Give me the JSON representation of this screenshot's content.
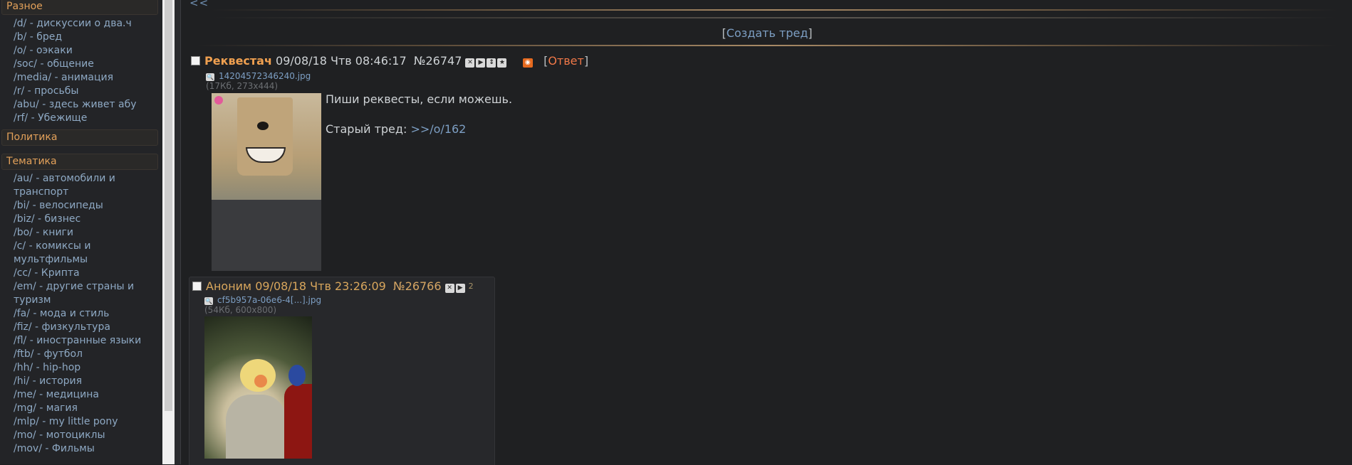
{
  "sidebar": {
    "categories": [
      {
        "title": "Разное",
        "boards": [
          "/d/ - дискуссии о два.ч",
          "/b/ - бред",
          "/o/ - оэкаки",
          "/soc/ - общение",
          "/media/ - анимация",
          "/r/ - просьбы",
          "/abu/ - здесь живет абу",
          "/rf/ - Убежище"
        ]
      },
      {
        "title": "Политика",
        "boards": []
      },
      {
        "title": "Тематика",
        "boards": [
          "/au/ - автомобили и транспорт",
          "/bi/ - велосипеды",
          "/biz/ - бизнес",
          "/bo/ - книги",
          "/c/ - комиксы и мультфильмы",
          "/cc/ - Крипта",
          "/em/ - другие страны и туризм",
          "/fa/ - мода и стиль",
          "/fiz/ - физкультура",
          "/fl/ - иностранные языки",
          "/ftb/ - футбол",
          "/hh/ - hip-hop",
          "/hi/ - история",
          "/me/ - медицина",
          "/mg/ - магия",
          "/mlp/ - my little pony",
          "/mo/ - мотоциклы",
          "/mov/ - Фильмы"
        ]
      }
    ]
  },
  "nav": {
    "back": "<<"
  },
  "create_thread": {
    "open": "[",
    "label": "Создать тред",
    "close": "]"
  },
  "colors": {
    "background": "#1f2022",
    "accent": "#f0a050",
    "link": "#7d9fc4",
    "reply": "#f07848"
  },
  "op": {
    "subject": "Реквестач",
    "date": "09/08/18 Чтв 08:46:17",
    "number": "№26747",
    "icons": [
      "hide-icon",
      "play-icon",
      "expand-icon",
      "star-icon"
    ],
    "rss_icon": "rss-icon",
    "reply_open": "[",
    "reply_label": "Ответ",
    "reply_close": "]",
    "file_name": "14204572346240.jpg",
    "file_meta": "(17Кб, 273x444)",
    "text_line1": "Пиши реквесты, если можешь.",
    "text_line2_prefix": "Старый тред: ",
    "text_line2_link": ">>/o/162"
  },
  "reply": {
    "author": "Аноним",
    "date": "09/08/18 Чтв 23:26:09",
    "number": "№26766",
    "icons": [
      "hide-icon",
      "play-icon"
    ],
    "count": "2",
    "file_name": "cf5b957a-06e6-4[...].jpg",
    "file_meta": "(54Кб, 600x800)"
  }
}
